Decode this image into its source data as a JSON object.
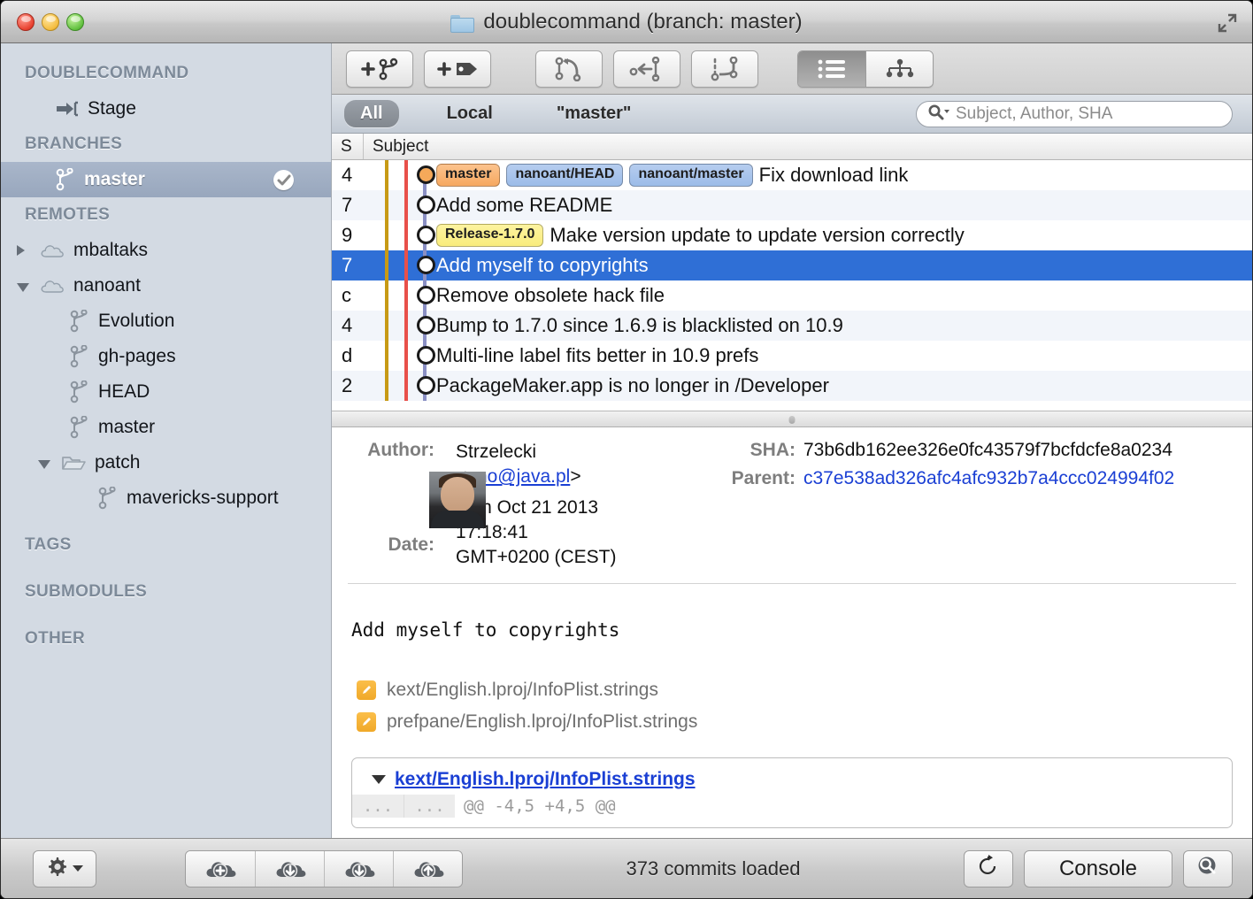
{
  "window": {
    "title": "doublecommand (branch: master)",
    "folder_icon": "folder-icon",
    "expand_icon": "expand-icon"
  },
  "sidebar": {
    "sections": [
      {
        "header": "DOUBLECOMMAND",
        "items": [
          {
            "label": "Stage",
            "icon": "stage-arrow-icon",
            "indent": 1,
            "selected": false
          }
        ]
      },
      {
        "header": "BRANCHES",
        "items": [
          {
            "label": "master",
            "icon": "branch-icon",
            "indent": 1,
            "selected": true,
            "badge": "checkmark-icon"
          }
        ]
      },
      {
        "header": "REMOTES",
        "items": [
          {
            "label": "mbaltaks",
            "icon": "cloud-icon",
            "indent": 0,
            "disclosure": "collapsed"
          },
          {
            "label": "nanoant",
            "icon": "cloud-icon",
            "indent": 0,
            "disclosure": "expanded"
          },
          {
            "label": "Evolution",
            "icon": "branch-icon",
            "indent": 2
          },
          {
            "label": "gh-pages",
            "icon": "branch-icon",
            "indent": 2
          },
          {
            "label": "HEAD",
            "icon": "branch-icon",
            "indent": 2
          },
          {
            "label": "master",
            "icon": "branch-icon",
            "indent": 2
          },
          {
            "label": "patch",
            "icon": "folder-open-icon",
            "indent": 1,
            "disclosure": "expanded"
          },
          {
            "label": "mavericks-support",
            "icon": "branch-icon",
            "indent": 3
          }
        ]
      },
      {
        "header": "TAGS",
        "items": []
      },
      {
        "header": "SUBMODULES",
        "items": []
      },
      {
        "header": "OTHER",
        "items": []
      }
    ]
  },
  "toolbar": {
    "buttons": [
      {
        "name": "new-branch-button",
        "icon": "plus-branch-icon"
      },
      {
        "name": "new-tag-button",
        "icon": "plus-tag-icon"
      },
      {
        "name": "merge-button",
        "icon": "merge-icon"
      },
      {
        "name": "cherry-pick-button",
        "icon": "cherry-pick-icon"
      },
      {
        "name": "rebase-button",
        "icon": "rebase-icon"
      }
    ],
    "view_toggle": [
      {
        "name": "list-view-button",
        "icon": "list-icon",
        "active": true
      },
      {
        "name": "tree-view-button",
        "icon": "tree-icon",
        "active": false
      }
    ]
  },
  "filterbar": {
    "pills": [
      {
        "label": "All",
        "active": true
      },
      {
        "label": "Local",
        "active": false
      },
      {
        "label": "\"master\"",
        "active": false
      }
    ],
    "search": {
      "placeholder": "Subject, Author, SHA",
      "value": "",
      "icon": "search-icon"
    }
  },
  "commit_list": {
    "columns": [
      "S",
      "Subject"
    ],
    "rows": [
      {
        "s": "4",
        "subject": "Fix download link",
        "node": "orange",
        "badges": [
          {
            "text": "master",
            "style": "orange"
          },
          {
            "text": "nanoant/HEAD",
            "style": "blue"
          },
          {
            "text": "nanoant/master",
            "style": "blue"
          }
        ],
        "selected": false,
        "alt": false
      },
      {
        "s": "7",
        "subject": "Add some README",
        "node": "white",
        "badges": [],
        "selected": false,
        "alt": true
      },
      {
        "s": "9",
        "subject": "Make version update to update version correctly",
        "node": "white",
        "badges": [
          {
            "text": "Release-1.7.0",
            "style": "yellow"
          }
        ],
        "selected": false,
        "alt": false
      },
      {
        "s": "7",
        "subject": "Add myself to copyrights",
        "node": "white",
        "badges": [],
        "selected": true,
        "alt": false
      },
      {
        "s": "c",
        "subject": "Remove obsolete hack file",
        "node": "white",
        "badges": [],
        "selected": false,
        "alt": false
      },
      {
        "s": "4",
        "subject": "Bump to 1.7.0 since 1.6.9 is blacklisted on 10.9",
        "node": "white",
        "badges": [],
        "selected": false,
        "alt": true
      },
      {
        "s": "d",
        "subject": "Multi-line label fits better in 10.9 prefs",
        "node": "white",
        "badges": [],
        "selected": false,
        "alt": false
      },
      {
        "s": "2",
        "subject": "PackageMaker.app is no longer in /Developer",
        "node": "white",
        "badges": [],
        "selected": false,
        "alt": true
      }
    ]
  },
  "detail": {
    "author_label": "Author:",
    "date_label": "Date:",
    "author_name": "Strzelecki",
    "author_email": "ono@java.pl",
    "date_value": "Mon Oct 21 2013 17:18:41 GMT+0200 (CEST)",
    "sha_label": "SHA:",
    "sha_value": "73b6db162ee326e0fc43579f7bcfdcfe8a0234",
    "parent_label": "Parent:",
    "parent_value": "c37e538ad326afc4afc932b7a4ccc024994f02",
    "message": "Add myself to copyrights",
    "files": [
      {
        "path": "kext/English.lproj/InfoPlist.strings",
        "status": "modified"
      },
      {
        "path": "prefpane/English.lproj/InfoPlist.strings",
        "status": "modified"
      }
    ],
    "diff": {
      "file": "kext/English.lproj/InfoPlist.strings",
      "gutter_left": "...",
      "gutter_right": "...",
      "hunk_header": "@@ -4,5 +4,5 @@"
    }
  },
  "bottombar": {
    "gear_label": "gear-icon",
    "actions": [
      {
        "name": "add-remote-button",
        "icon": "cloud-plus-icon"
      },
      {
        "name": "fetch-button",
        "icon": "cloud-download-icon"
      },
      {
        "name": "pull-button",
        "icon": "cloud-down-icon"
      },
      {
        "name": "push-button",
        "icon": "cloud-up-icon"
      }
    ],
    "status": "373 commits loaded",
    "refresh_label": "refresh-icon",
    "console_label": "Console",
    "search_label": "search-icon"
  },
  "colors": {
    "selection_blue": "#2f6fd6",
    "badge_orange": "#f6a860",
    "badge_blue": "#9cbce8",
    "badge_yellow": "#f9ec7c",
    "graph_olive": "#c79a15",
    "graph_red": "#e8504a",
    "graph_purple": "#8a8fc4",
    "link_blue": "#1a3fd4"
  }
}
